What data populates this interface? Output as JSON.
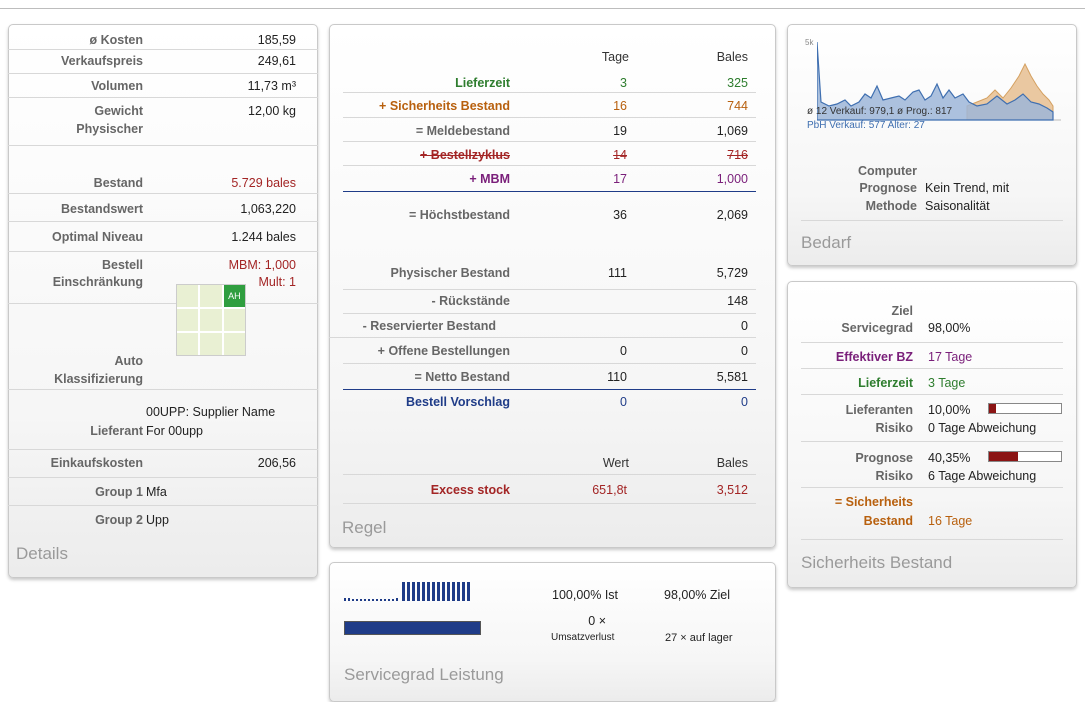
{
  "details": {
    "title": "Details",
    "rows": [
      {
        "label": "ø Kosten",
        "value": "185,59"
      },
      {
        "label": "Verkaufspreis",
        "value": "249,61"
      },
      {
        "label": "Volumen",
        "value": "11,73 m³"
      },
      {
        "label": "Gewicht",
        "value": "12,00 kg"
      },
      {
        "label1": "Physischer",
        "label2": "Bestand",
        "value": "5.729 bales"
      },
      {
        "label": "Bestandswert",
        "value": "1,063,220"
      },
      {
        "label": "Optimal Niveau",
        "value": "1.244 bales"
      },
      {
        "label1": "Bestell",
        "label2": "Einschränkung",
        "value1": "MBM: 1,000",
        "value2": "Mult: 1"
      },
      {
        "label1": "Auto",
        "label2": "Klassifizierung",
        "cell": "AH"
      },
      {
        "label": "Lieferant",
        "value1": "00UPP: Supplier Name",
        "value2": "For 00upp"
      },
      {
        "label": "Einkaufskosten",
        "value": "206,56"
      },
      {
        "label": "Group 1",
        "value": "Mfa"
      },
      {
        "label": "Group 2",
        "value": "Upp"
      }
    ]
  },
  "regel": {
    "title": "Regel",
    "col_tage": "Tage",
    "col_bales": "Bales",
    "col_wert": "Wert",
    "rows": [
      {
        "label": "Lieferzeit",
        "tage": "3",
        "bales": "325"
      },
      {
        "label": "+ Sicherheits Bestand",
        "tage": "16",
        "bales": "744"
      },
      {
        "label": "= Meldebestand",
        "tage": "19",
        "bales": "1,069"
      },
      {
        "label": "+ Bestellzyklus",
        "tage": "14",
        "bales": "716"
      },
      {
        "label": "+ MBM",
        "tage": "17",
        "bales": "1,000"
      },
      {
        "label": "= Höchstbestand",
        "tage": "36",
        "bales": "2,069"
      },
      {
        "label": "Physischer Bestand",
        "tage": "111",
        "bales": "5,729"
      },
      {
        "label": "- Rückstände",
        "tage": "",
        "bales": "148"
      },
      {
        "label": "- Reservierter Bestand",
        "tage": "",
        "bales": "0"
      },
      {
        "label": "+ Offene Bestellungen",
        "tage": "0",
        "bales": "0"
      },
      {
        "label": "= Netto Bestand",
        "tage": "110",
        "bales": "5,581"
      },
      {
        "label": "Bestell Vorschlag",
        "tage": "0",
        "bales": "0"
      },
      {
        "label": "Excess stock",
        "wert": "651,8t",
        "bales": "3,512"
      }
    ]
  },
  "bedarf": {
    "title": "Bedarf",
    "chart_ylabel": "5k",
    "line1": "ø 12 Verkauf: 979,1 ø Prog.: 817",
    "line2": "PbH Verkauf: 577 Alter: 27",
    "label1": "Computer",
    "label2": "Prognose",
    "label3": "Methode",
    "value2": "Kein Trend, mit",
    "value3": "Saisonalität",
    "colors": {
      "sales": "#3f6fb0",
      "forecast": "#d4a060"
    }
  },
  "sicherheit": {
    "title": "Sicherheits Bestand",
    "ziel_label1": "Ziel",
    "ziel_label2": "Servicegrad",
    "ziel_value": "98,00%",
    "eff_label": "Effektiver BZ",
    "eff_value": "17 Tage",
    "lz_label": "Lieferzeit",
    "lz_value": "3 Tage",
    "lief_label1": "Lieferanten",
    "lief_label2": "Risiko",
    "lief_pct": "10,00%",
    "lief_fill": 0.1,
    "lief_dev": "0 Tage Abweichung",
    "prog_label1": "Prognose",
    "prog_label2": "Risiko",
    "prog_pct": "40,35%",
    "prog_fill": 0.4035,
    "prog_dev": "6 Tage Abweichung",
    "sb_label1": "= Sicherheits",
    "sb_label2": "Bestand",
    "sb_value": "16 Tage"
  },
  "service": {
    "title": "Servicegrad Leistung",
    "ist": "100,00% Ist",
    "ziel": "98,00% Ziel",
    "lost_count": "0 ×",
    "lost_label": "Umsatzverlust",
    "stock": "27 × auf lager",
    "fill": 1.0
  }
}
